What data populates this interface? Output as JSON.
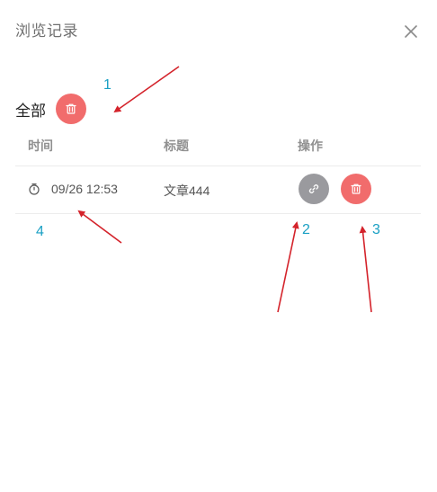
{
  "dialog": {
    "title": "浏览记录",
    "close_icon": "close-icon"
  },
  "section": {
    "label": "全部",
    "clear_all_icon": "trash-icon"
  },
  "table": {
    "columns": [
      "时间",
      "标题",
      "操作"
    ],
    "rows": [
      {
        "time": "09/26 12:53",
        "title": "文章444",
        "time_icon": "stopwatch-icon",
        "link_icon": "link-icon",
        "delete_icon": "trash-icon"
      }
    ]
  },
  "annotations": {
    "labels": [
      "1",
      "2",
      "3",
      "4"
    ],
    "color": "#1aa0c4",
    "arrow_color": "#d4232b"
  },
  "colors": {
    "danger": "#f16c6c",
    "gray_button": "#9a9a9e"
  }
}
